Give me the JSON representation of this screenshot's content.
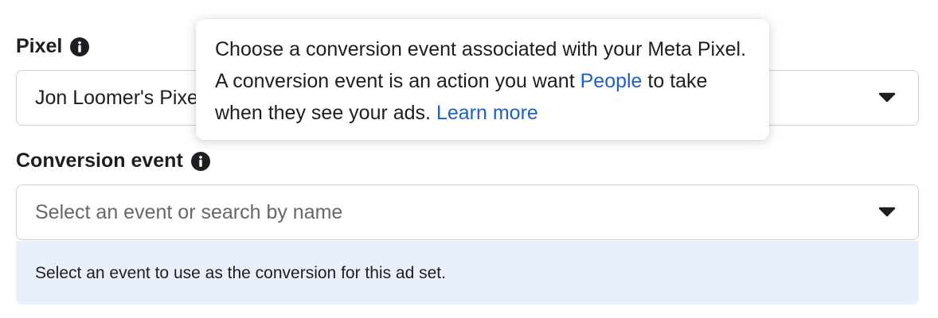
{
  "pixel": {
    "label": "Pixel",
    "selected_value": "Jon Loomer's Pixel"
  },
  "conversion_event": {
    "label": "Conversion event",
    "placeholder": "Select an event or search by name",
    "hint": "Select an event to use as the conversion for this ad set."
  },
  "tooltip": {
    "text_before_link": "Choose a conversion event associated with your Meta Pixel. A conversion event is an action you want ",
    "people_link": "People",
    "text_after_link": " to take when they see your ads. ",
    "learn_more_link": "Learn more"
  },
  "icons": {
    "info": "info-icon",
    "dropdown": "caret-down-icon"
  },
  "colors": {
    "link": "#1e60c9",
    "hint_background": "#eaf0fb",
    "border": "#ccd0d5"
  }
}
